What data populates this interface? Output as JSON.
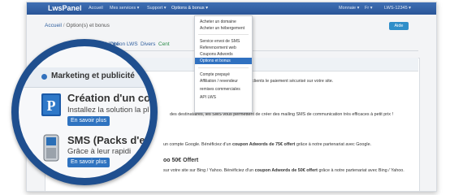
{
  "topbar": {
    "brand": "LwsPanel",
    "nav": [
      "Accueil",
      "Mes services ▾",
      "Support ▾",
      "Options & bonus ▾"
    ],
    "right": [
      "Monnaie ▾",
      "Fr ▾",
      "LWS-12345 ▾"
    ]
  },
  "breadcrumb": [
    "Accueil",
    "Option(s) et bonus"
  ],
  "aide_button": "Aide",
  "tabs": [
    "Marketing et publicité",
    "Option LWS",
    "Divers",
    "Cent"
  ],
  "dropdown": {
    "group1": [
      "Acheter un domaine",
      "Acheter un hébergement"
    ],
    "group2": [
      "Service envoi de SMS",
      "Referencement web",
      "Coupons Adwords",
      "Options et bonus"
    ],
    "group3": [
      "Compte prepayé",
      "Affiliation / revendeur",
      "remises commerciales",
      "API LWS"
    ],
    "selected": "Options et bonus"
  },
  "section_title": "Marketing et publicité",
  "items": [
    {
      "title": "Création d'un co",
      "subtitle": "Installez la solution la pl",
      "button": "En savoir plus",
      "right_text": "proposer à vos clients le paiement sécurisé sur votre site.",
      "icon": "paypal-icon"
    },
    {
      "title": "SMS (Packs d'e",
      "subtitle": "Grâce à leur rapidi",
      "button": "En savoir plus",
      "right_text": "des destinataires, les SMS vous permettent de créer des mailing SMS de communication très efficaces à petit prix !",
      "icon": "mobile-phone-icon"
    }
  ],
  "behind_lines": {
    "line_google_a": "un compte Google. Bénéficiez d'un",
    "line_google_b": "coupon Adwords de 75€ offert",
    "line_google_c": "grâce à notre partenariat avec Google.",
    "title_bing": "oo 50€ Offert",
    "line_bing_a": "sur votre site sur Bing / Yahoo. Bénéficiez d'un",
    "line_bing_b": "coupon Adwords de 50€ offert",
    "line_bing_c": "grâce à notre partenariat avec Bing / Yahoo.",
    "line_mons": "mons",
    "line_tern": "terne"
  },
  "colors": {
    "topbar": "#2f5f9e",
    "accent": "#2f73c0",
    "ring": "#1f4f8f"
  }
}
